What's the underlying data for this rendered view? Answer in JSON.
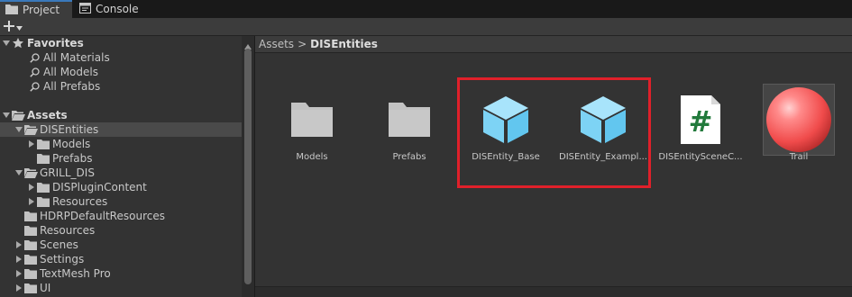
{
  "tabs": [
    {
      "label": "Project",
      "icon": "folder-icon"
    },
    {
      "label": "Console",
      "icon": "console-icon"
    }
  ],
  "toolbar": {
    "create_icon": "plus-icon"
  },
  "tree": {
    "favorites": {
      "label": "Favorites",
      "items": [
        "All Materials",
        "All Models",
        "All Prefabs"
      ]
    },
    "assets": {
      "label": "Assets",
      "dis_entities": {
        "label": "DISEntities",
        "children": [
          "Models",
          "Prefabs"
        ]
      },
      "grill_dis": {
        "label": "GRILL_DIS",
        "children": [
          "DISPluginContent",
          "Resources"
        ]
      },
      "others": [
        "HDRPDefaultResources",
        "Resources",
        "Scenes",
        "Settings",
        "TextMesh Pro",
        "UI"
      ]
    }
  },
  "breadcrumb": {
    "root": "Assets",
    "separator": ">",
    "current": "DISEntities"
  },
  "assets": [
    {
      "name": "Models",
      "kind": "folder"
    },
    {
      "name": "Prefabs",
      "kind": "folder"
    },
    {
      "name": "DISEntity_Base",
      "kind": "prefab"
    },
    {
      "name": "DISEntity_Exampl...",
      "kind": "prefab"
    },
    {
      "name": "DISEntitySceneC...",
      "kind": "script",
      "glyph": "#"
    },
    {
      "name": "Trail",
      "kind": "material"
    }
  ],
  "colors": {
    "accent": "#3a79bb",
    "highlight_box": "#e0202a",
    "prefab": "#7dd3f5",
    "material": "#ff5a5a",
    "folder": "#c2c2c2"
  }
}
